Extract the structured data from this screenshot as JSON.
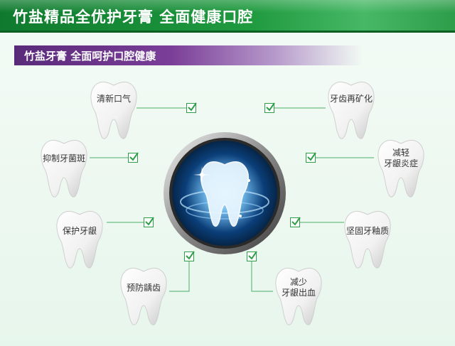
{
  "header": {
    "title": "竹盐精品全优护牙膏  全面健康口腔"
  },
  "subheader": {
    "title": "竹盐牙膏  全面呵护口腔健康"
  },
  "features": {
    "left": [
      {
        "label": "清新口气"
      },
      {
        "label": "抑制牙菌斑"
      },
      {
        "label": "保护牙龈"
      },
      {
        "label": "预防龋齿"
      }
    ],
    "right": [
      {
        "label": "牙齿再矿化"
      },
      {
        "label_line1": "减轻",
        "label_line2": "牙龈炎症"
      },
      {
        "label": "坚固牙釉质"
      },
      {
        "label_line1": "减少",
        "label_line2": "牙龈出血"
      }
    ]
  },
  "colors": {
    "header_green": "#1f9a3f",
    "subheader_purple": "#7a3e98",
    "check_green": "#2f9e48",
    "background": "#eaf6ee"
  },
  "icons": {
    "feature_check": "checkbox-check-icon",
    "center_image": "glowing-tooth-icon"
  }
}
